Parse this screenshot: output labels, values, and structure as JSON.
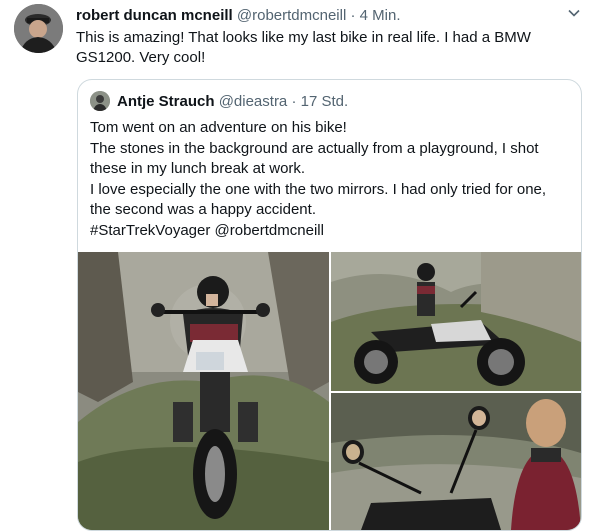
{
  "tweet": {
    "author_name": "robert duncan mcneill",
    "handle": "@robertdmcneill",
    "separator": "·",
    "time": "4 Min.",
    "text": "This is amazing! That looks like my last bike in real life. I had a BMW GS1200. Very cool!"
  },
  "quote": {
    "author_name": "Antje Strauch",
    "handle": "@dieastra",
    "separator": "·",
    "time": "17 Std.",
    "lines": [
      "Tom went on an adventure on his bike!",
      "The stones in the background are actually from a playground, I shot",
      "these in my lunch break at work.",
      "I love especially the one with the two mirrors. I had only tried for one,",
      "the second was a happy accident.",
      "#StarTrekVoyager @robertdmcneill"
    ]
  },
  "icons": {
    "more": "chevron-down-icon"
  },
  "colors": {
    "text": "#0f1419",
    "muted": "#536471",
    "border": "#cfd9de"
  }
}
